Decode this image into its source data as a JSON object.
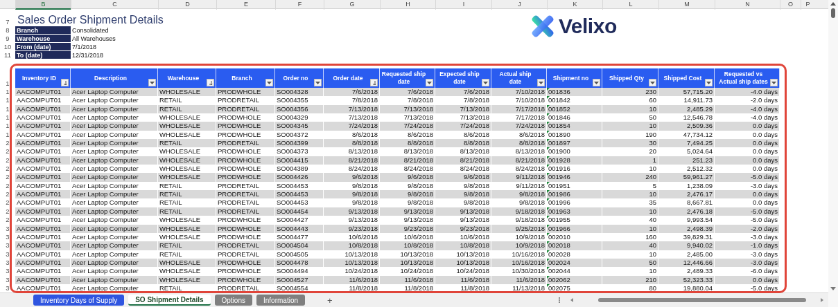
{
  "column_letters": [
    {
      "label": "B",
      "selected": true
    },
    {
      "label": "C",
      "selected": false
    },
    {
      "label": "D",
      "selected": false
    },
    {
      "label": "E",
      "selected": false
    },
    {
      "label": "F",
      "selected": false
    },
    {
      "label": "G",
      "selected": false
    },
    {
      "label": "H",
      "selected": false
    },
    {
      "label": "I",
      "selected": false
    },
    {
      "label": "J",
      "selected": false
    },
    {
      "label": "K",
      "selected": false
    },
    {
      "label": "L",
      "selected": false
    },
    {
      "label": "M",
      "selected": false
    },
    {
      "label": "N",
      "selected": false
    },
    {
      "label": "O",
      "selected": false
    },
    {
      "label": "P",
      "selected": false
    }
  ],
  "report": {
    "title_row": "7",
    "title": "Sales Order Shipment Details",
    "filters": [
      {
        "row": "8",
        "label": "Branch",
        "value": "Consolidated"
      },
      {
        "row": "9",
        "label": "Warehouse",
        "value": "All Warehouses"
      },
      {
        "row": "10",
        "label": "From (date)",
        "value": "7/1/2018"
      },
      {
        "row": "11",
        "label": "To (date)",
        "value": "12/31/2018"
      }
    ]
  },
  "logo": {
    "text": "Velixo"
  },
  "table": {
    "header_row": "1",
    "columns": [
      {
        "label": "Inventory ID",
        "kind": "text",
        "sorted": true,
        "flagged": false
      },
      {
        "label": "Description",
        "kind": "text",
        "sorted": false,
        "flagged": false
      },
      {
        "label": "Warehouse",
        "kind": "text",
        "sorted": true,
        "flagged": false
      },
      {
        "label": "Branch",
        "kind": "text",
        "sorted": false,
        "flagged": false
      },
      {
        "label": "Order no",
        "kind": "text",
        "sorted": false,
        "flagged": false
      },
      {
        "label": "Order date",
        "kind": "value",
        "sorted": true,
        "flagged": false
      },
      {
        "label": "Requested ship date",
        "kind": "value",
        "sorted": false,
        "flagged": false
      },
      {
        "label": "Expected ship date",
        "kind": "value",
        "sorted": false,
        "flagged": false
      },
      {
        "label": "Actual ship date",
        "kind": "value",
        "sorted": false,
        "flagged": false
      },
      {
        "label": "Shipment no",
        "kind": "text",
        "sorted": false,
        "flagged": true
      },
      {
        "label": "Shipped Qty",
        "kind": "value",
        "sorted": false,
        "flagged": false
      },
      {
        "label": "Shipped Cost",
        "kind": "value",
        "sorted": false,
        "flagged": false
      },
      {
        "label": "Requested vs Actual ship dates",
        "kind": "value",
        "sorted": false,
        "flagged": false
      }
    ],
    "rows": [
      {
        "row": "1",
        "cells": [
          "AACOMPUT01",
          "Acer Laptop Computer",
          "WHOLESALE",
          "PRODWHOLE",
          "SO004328",
          "7/6/2018",
          "7/6/2018",
          "7/6/2018",
          "7/10/2018",
          "001836",
          "230",
          "57,715.20",
          "-4.0 days"
        ]
      },
      {
        "row": "1",
        "cells": [
          "AACOMPUT01",
          "Acer Laptop Computer",
          "RETAIL",
          "PRODRETAIL",
          "SO004355",
          "7/8/2018",
          "7/8/2018",
          "7/8/2018",
          "7/10/2018",
          "001842",
          "60",
          "14,911.73",
          "-2.0 days"
        ]
      },
      {
        "row": "1",
        "cells": [
          "AACOMPUT01",
          "Acer Laptop Computer",
          "RETAIL",
          "PRODRETAIL",
          "SO004356",
          "7/13/2018",
          "7/13/2018",
          "7/13/2018",
          "7/17/2018",
          "001852",
          "10",
          "2,485.29",
          "-4.0 days"
        ]
      },
      {
        "row": "1",
        "cells": [
          "AACOMPUT01",
          "Acer Laptop Computer",
          "WHOLESALE",
          "PRODWHOLE",
          "SO004329",
          "7/13/2018",
          "7/13/2018",
          "7/13/2018",
          "7/17/2018",
          "001846",
          "50",
          "12,546.78",
          "-4.0 days"
        ]
      },
      {
        "row": "1",
        "cells": [
          "AACOMPUT01",
          "Acer Laptop Computer",
          "WHOLESALE",
          "PRODWHOLE",
          "SO004345",
          "7/24/2018",
          "7/24/2018",
          "7/24/2018",
          "7/24/2018",
          "001854",
          "10",
          "2,509.36",
          "0.0 days"
        ]
      },
      {
        "row": "1",
        "cells": [
          "AACOMPUT01",
          "Acer Laptop Computer",
          "WHOLESALE",
          "PRODWHOLE",
          "SO004372",
          "8/6/2018",
          "8/6/2018",
          "8/6/2018",
          "8/6/2018",
          "001890",
          "190",
          "47,734.12",
          "0.0 days"
        ]
      },
      {
        "row": "2",
        "cells": [
          "AACOMPUT01",
          "Acer Laptop Computer",
          "RETAIL",
          "PRODRETAIL",
          "SO004399",
          "8/8/2018",
          "8/8/2018",
          "8/8/2018",
          "8/8/2018",
          "001897",
          "30",
          "7,494.25",
          "0.0 days"
        ]
      },
      {
        "row": "2",
        "cells": [
          "AACOMPUT01",
          "Acer Laptop Computer",
          "WHOLESALE",
          "PRODWHOLE",
          "SO004373",
          "8/13/2018",
          "8/13/2018",
          "8/13/2018",
          "8/13/2018",
          "001900",
          "20",
          "5,024.64",
          "0.0 days"
        ]
      },
      {
        "row": "2",
        "cells": [
          "AACOMPUT01",
          "Acer Laptop Computer",
          "WHOLESALE",
          "PRODWHOLE",
          "SO004415",
          "8/21/2018",
          "8/21/2018",
          "8/21/2018",
          "8/21/2018",
          "001928",
          "1",
          "251.23",
          "0.0 days"
        ]
      },
      {
        "row": "2",
        "cells": [
          "AACOMPUT01",
          "Acer Laptop Computer",
          "WHOLESALE",
          "PRODWHOLE",
          "SO004389",
          "8/24/2018",
          "8/24/2018",
          "8/24/2018",
          "8/24/2018",
          "001916",
          "10",
          "2,512.32",
          "0.0 days"
        ]
      },
      {
        "row": "2",
        "cells": [
          "AACOMPUT01",
          "Acer Laptop Computer",
          "WHOLESALE",
          "PRODWHOLE",
          "SO004426",
          "9/6/2018",
          "9/6/2018",
          "9/6/2018",
          "9/11/2018",
          "001946",
          "240",
          "59,961.27",
          "-5.0 days"
        ]
      },
      {
        "row": "2",
        "cells": [
          "AACOMPUT01",
          "Acer Laptop Computer",
          "RETAIL",
          "PRODRETAIL",
          "SO004453",
          "9/8/2018",
          "9/8/2018",
          "9/8/2018",
          "9/11/2018",
          "001951",
          "5",
          "1,238.09",
          "-3.0 days"
        ]
      },
      {
        "row": "2",
        "cells": [
          "AACOMPUT01",
          "Acer Laptop Computer",
          "RETAIL",
          "PRODRETAIL",
          "SO004453",
          "9/8/2018",
          "9/8/2018",
          "9/8/2018",
          "9/8/2018",
          "001986",
          "10",
          "2,476.17",
          "0.0 days"
        ]
      },
      {
        "row": "2",
        "cells": [
          "AACOMPUT01",
          "Acer Laptop Computer",
          "RETAIL",
          "PRODRETAIL",
          "SO004453",
          "9/8/2018",
          "9/8/2018",
          "9/8/2018",
          "9/8/2018",
          "001996",
          "35",
          "8,667.81",
          "0.0 days"
        ]
      },
      {
        "row": "2",
        "cells": [
          "AACOMPUT01",
          "Acer Laptop Computer",
          "RETAIL",
          "PRODRETAIL",
          "SO004454",
          "9/13/2018",
          "9/13/2018",
          "9/13/2018",
          "9/18/2018",
          "001963",
          "10",
          "2,476.18",
          "-5.0 days"
        ]
      },
      {
        "row": "2",
        "cells": [
          "AACOMPUT01",
          "Acer Laptop Computer",
          "WHOLESALE",
          "PRODWHOLE",
          "SO004427",
          "9/13/2018",
          "9/13/2018",
          "9/13/2018",
          "9/18/2018",
          "001955",
          "40",
          "9,993.54",
          "-5.0 days"
        ]
      },
      {
        "row": "3",
        "cells": [
          "AACOMPUT01",
          "Acer Laptop Computer",
          "WHOLESALE",
          "PRODWHOLE",
          "SO004443",
          "9/23/2018",
          "9/23/2018",
          "9/23/2018",
          "9/25/2018",
          "001966",
          "10",
          "2,498.39",
          "-2.0 days"
        ]
      },
      {
        "row": "3",
        "cells": [
          "AACOMPUT01",
          "Acer Laptop Computer",
          "WHOLESALE",
          "PRODWHOLE",
          "SO004477",
          "10/6/2018",
          "10/6/2018",
          "10/6/2018",
          "10/9/2018",
          "002010",
          "160",
          "39,829.31",
          "-3.0 days"
        ]
      },
      {
        "row": "3",
        "cells": [
          "AACOMPUT01",
          "Acer Laptop Computer",
          "RETAIL",
          "PRODRETAIL",
          "SO004504",
          "10/8/2018",
          "10/8/2018",
          "10/8/2018",
          "10/9/2018",
          "002018",
          "40",
          "9,940.02",
          "-1.0 days"
        ]
      },
      {
        "row": "3",
        "cells": [
          "AACOMPUT01",
          "Acer Laptop Computer",
          "RETAIL",
          "PRODRETAIL",
          "SO004505",
          "10/13/2018",
          "10/13/2018",
          "10/13/2018",
          "10/16/2018",
          "002028",
          "10",
          "2,485.00",
          "-3.0 days"
        ]
      },
      {
        "row": "3",
        "cells": [
          "AACOMPUT01",
          "Acer Laptop Computer",
          "WHOLESALE",
          "PRODWHOLE",
          "SO004478",
          "10/13/2018",
          "10/13/2018",
          "10/13/2018",
          "10/16/2018",
          "002024",
          "50",
          "12,446.66",
          "-3.0 days"
        ]
      },
      {
        "row": "3",
        "cells": [
          "AACOMPUT01",
          "Acer Laptop Computer",
          "WHOLESALE",
          "PRODWHOLE",
          "SO004494",
          "10/24/2018",
          "10/24/2018",
          "10/24/2018",
          "10/30/2018",
          "002044",
          "10",
          "2,489.33",
          "-6.0 days"
        ]
      },
      {
        "row": "3",
        "cells": [
          "AACOMPUT01",
          "Acer Laptop Computer",
          "WHOLESALE",
          "PRODWHOLE",
          "SO004527",
          "11/6/2018",
          "11/6/2018",
          "11/6/2018",
          "11/6/2018",
          "002062",
          "210",
          "52,323.33",
          "0.0 days"
        ]
      },
      {
        "row": "3",
        "cells": [
          "AACOMPUT01",
          "Acer Laptop Computer",
          "RETAIL",
          "PRODRETAIL",
          "SO004554",
          "11/8/2018",
          "11/8/2018",
          "11/8/2018",
          "11/13/2018",
          "002075",
          "80",
          "19,880.04",
          "-5.0 days"
        ]
      }
    ]
  },
  "sheet_tabs": [
    {
      "label": "Inventory Days of Supply",
      "selected": false,
      "color": "#2f55e0"
    },
    {
      "label": "SO Shipment Details",
      "selected": true,
      "color": "#ffffff"
    },
    {
      "label": "Options",
      "selected": false,
      "color": "#7f7f7f"
    },
    {
      "label": "Information",
      "selected": false,
      "color": "#7f7f7f"
    }
  ],
  "add_sheet": "+"
}
